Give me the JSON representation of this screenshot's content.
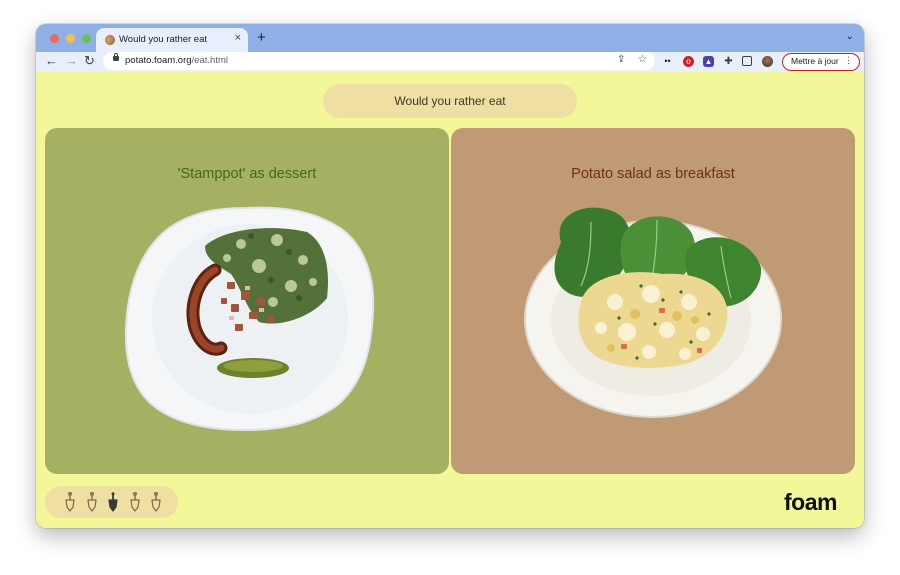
{
  "browser": {
    "tab_title": "Would you rather eat",
    "tab_close": "×",
    "new_tab": "+",
    "tab_menu": "⌄",
    "nav": {
      "back": "←",
      "forward": "→",
      "reload": "↻"
    },
    "url_host": "potato.foam.org",
    "url_path": "/eat.html",
    "update_label": "Mettre à jour",
    "update_menu": "⋮",
    "traffic_lights": {
      "close": "#ed6a5e",
      "minimize": "#f4bf4f",
      "zoom": "#61c554"
    }
  },
  "page": {
    "question": "Would you rather eat",
    "options": [
      {
        "title": "'Stamppot' as dessert",
        "image": "plate-stamppot-sausage-pickle",
        "background": "#a6b062"
      },
      {
        "title": "Potato salad as breakfast",
        "image": "plate-potato-salad-lettuce",
        "background": "#c09a74"
      }
    ],
    "rating": {
      "icon": "shovel-icon",
      "count": 5,
      "selected": 3
    },
    "logo": "foam"
  }
}
